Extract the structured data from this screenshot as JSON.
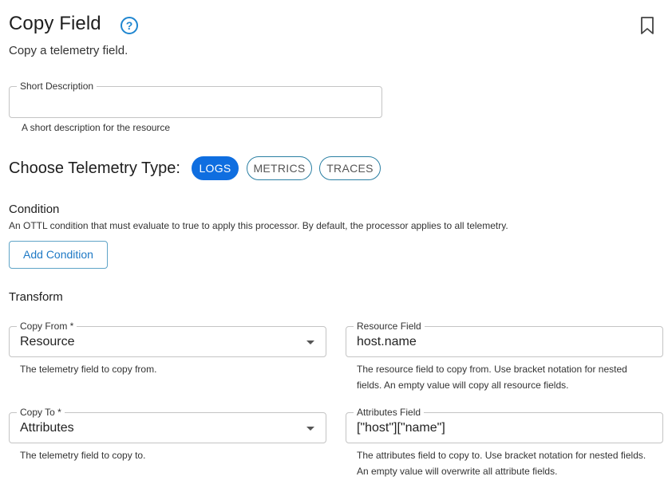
{
  "header": {
    "title": "Copy Field",
    "subtitle": "Copy a telemetry field."
  },
  "short_description": {
    "label": "Short Description",
    "value": "",
    "helper": "A short description for the resource"
  },
  "telemetry": {
    "heading": "Choose Telemetry Type:",
    "options": [
      "LOGS",
      "METRICS",
      "TRACES"
    ],
    "selected": "LOGS"
  },
  "condition": {
    "label": "Condition",
    "description": "An OTTL condition that must evaluate to true to apply this processor. By default, the processor applies to all telemetry.",
    "add_button": "Add Condition"
  },
  "transform": {
    "label": "Transform",
    "copy_from": {
      "label": "Copy From *",
      "value": "Resource",
      "helper": "The telemetry field to copy from."
    },
    "resource_field": {
      "label": "Resource Field",
      "value": "host.name",
      "helper_line1": "The resource field to copy from. Use bracket notation for nested",
      "helper_line2": "fields. An empty value will copy all resource fields."
    },
    "copy_to": {
      "label": "Copy To *",
      "value": "Attributes",
      "helper": "The telemetry field to copy to."
    },
    "attributes_field": {
      "label": "Attributes Field",
      "value": "[\"host\"][\"name\"]",
      "helper_line1": "The attributes field to copy to. Use bracket notation for nested fields.",
      "helper_line2": "An empty value will overwrite all attribute fields."
    }
  },
  "colors": {
    "accent": "#0f6ee0",
    "button_text": "#1e79c5",
    "outline": "#2a7fa3"
  },
  "icons": {
    "help": "question-circle-icon",
    "bookmark": "bookmark-icon"
  }
}
